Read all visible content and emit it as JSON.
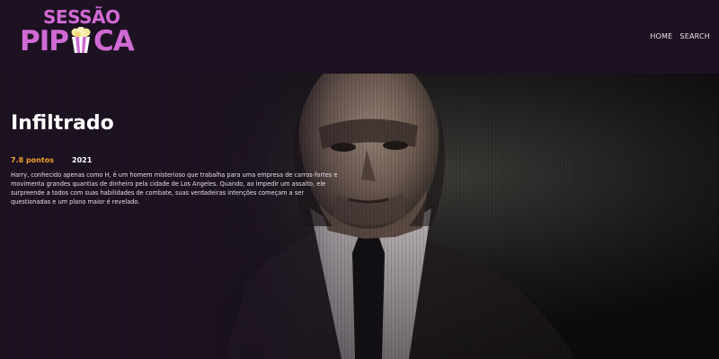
{
  "brand": {
    "line1": "SESSÃO",
    "line2_part1": "PIP",
    "line2_part2": "CA",
    "logo_icon": "popcorn-icon",
    "color": "#d06ad4"
  },
  "nav": {
    "home": "HOME",
    "search": "SEARCH"
  },
  "movie": {
    "title": "Infiltrado",
    "rating": "7.8 pontos",
    "year": "2021",
    "overview": "Harry, conhecido apenas como H, é um homem misterioso que trabalha para uma empresa de carros-fortes e movimenta grandes quantias de dinheiro pela cidade de Los Angeles. Quando, ao impedir um assalto, ele surpreende a todos com suas habilidades de combate, suas verdadeiras intenções começam a ser questionadas e um plano maior é revelado."
  },
  "colors": {
    "background": "#1d1222",
    "rating": "#f0a22a",
    "text": "#ffffff"
  }
}
